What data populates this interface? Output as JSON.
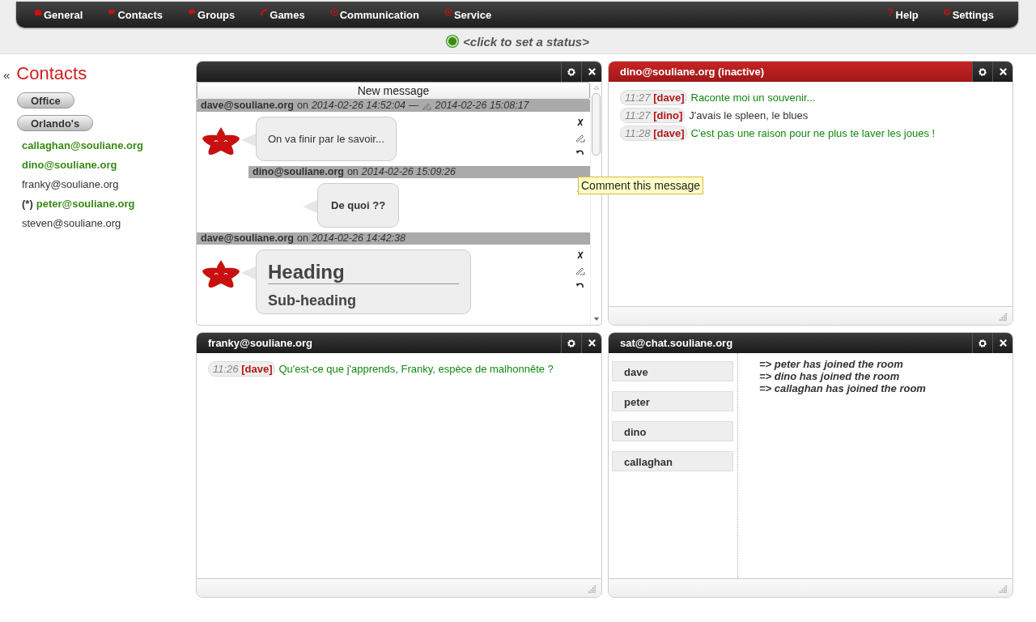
{
  "menu": {
    "left": [
      {
        "label": "General"
      },
      {
        "label": "Contacts"
      },
      {
        "label": "Groups"
      },
      {
        "label": "Games"
      },
      {
        "label": "Communication"
      },
      {
        "label": "Service"
      }
    ],
    "right": [
      {
        "label": "Help"
      },
      {
        "label": "Settings"
      }
    ]
  },
  "status": {
    "text": "<click to set a status>",
    "online": true
  },
  "sidebar": {
    "collapse": "«",
    "title": "Contacts",
    "groups": [
      "Office",
      "Orlando's"
    ],
    "contacts": [
      {
        "name": "callaghan@souliane.org",
        "online": true
      },
      {
        "name": "dino@souliane.org",
        "online": true
      },
      {
        "name": "franky@souliane.org",
        "online": false
      },
      {
        "marker": "(*)",
        "name": "peter@souliane.org",
        "online": true
      },
      {
        "name": "steven@souliane.org",
        "online": false
      }
    ]
  },
  "panels": [
    {
      "kind": "blog",
      "alert": false,
      "new_message": "New message",
      "entries": [
        {
          "author": "dave@souliane.org",
          "on": "on",
          "date": "2014-02-26 14:52:04",
          "separator": "—",
          "edited": "2014-02-26 15:08:17",
          "body": [
            {
              "kind": "text",
              "text": "On va finir par le savoir...",
              "bold": false
            }
          ],
          "children": [
            {
              "author": "dino@souliane.org",
              "on": "on",
              "date": "2014-02-26 15:09:26",
              "body": [
                {
                  "kind": "text",
                  "text": "De quoi ??",
                  "bold": true
                }
              ]
            }
          ]
        },
        {
          "author": "dave@souliane.org",
          "on": "on",
          "date": "2014-02-26 14:42:38",
          "body": [
            {
              "kind": "heading",
              "text": "Heading"
            },
            {
              "kind": "subheading",
              "text": "Sub-heading"
            }
          ]
        }
      ]
    },
    {
      "kind": "chat",
      "title": "dino@souliane.org (inactive)",
      "alert": true,
      "messages": [
        {
          "time": "11:27",
          "nick": "[dave]",
          "text": "Raconte moi un souvenir...",
          "own": true
        },
        {
          "time": "11:27",
          "nick": "[dino]",
          "text": "J'avais le spleen, le blues",
          "own": false
        },
        {
          "time": "11:28",
          "nick": "[dave]",
          "text": "C'est pas une raison pour ne plus te laver les joues !",
          "own": true
        }
      ]
    },
    {
      "kind": "chat",
      "title": "franky@souliane.org",
      "alert": false,
      "messages": [
        {
          "time": "11:26",
          "nick": "[dave]",
          "text": "Qu'est-ce que j'apprends, Franky, espèce de malhonnête ?",
          "own": true
        }
      ]
    },
    {
      "kind": "muc",
      "title": "sat@chat.souliane.org",
      "alert": false,
      "occupants": [
        "dave",
        "peter",
        "dino",
        "callaghan"
      ],
      "messages": [
        "=> peter has joined the room",
        "=> dino has joined the room",
        "=> callaghan has joined the room"
      ]
    }
  ],
  "tooltip": "Comment this message"
}
